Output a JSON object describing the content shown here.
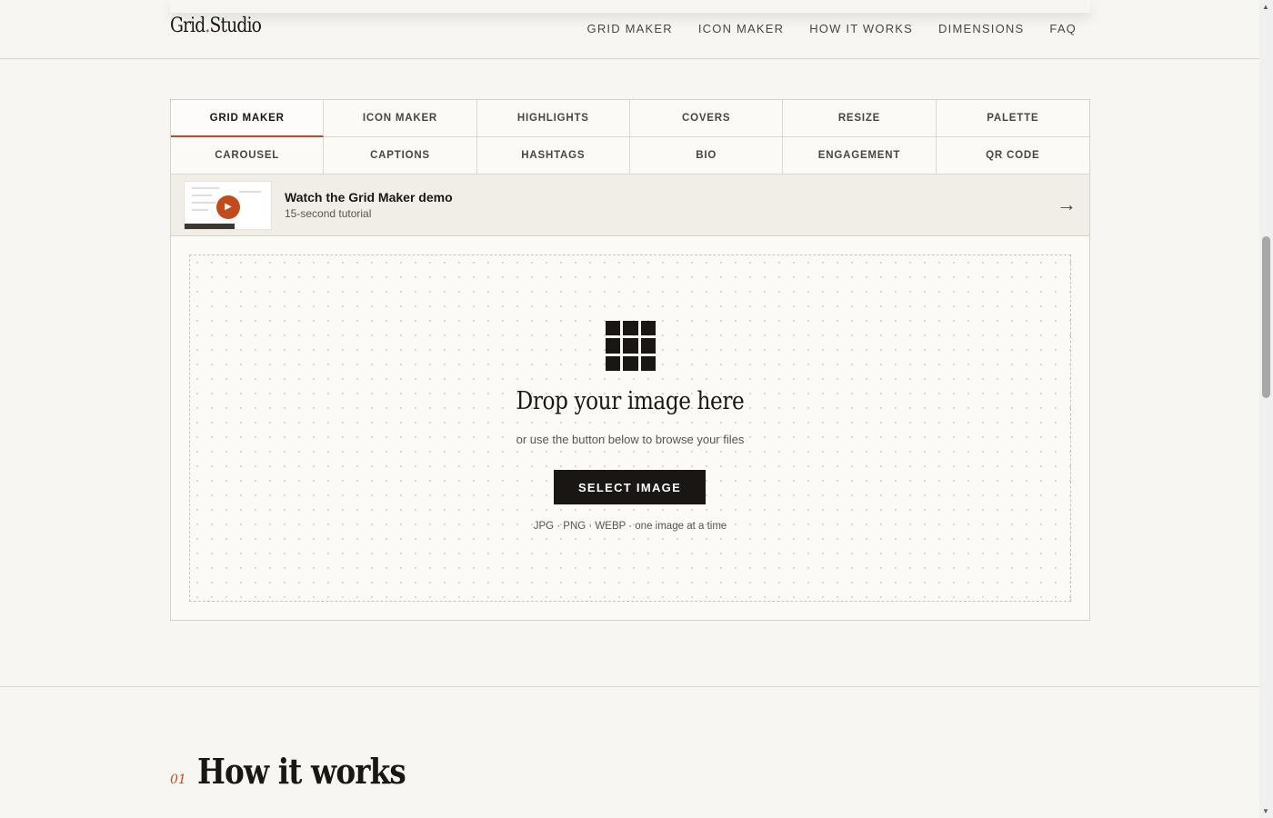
{
  "header": {
    "logo_main": "Grid",
    "logo_dot": ".",
    "logo_tail": "Studio",
    "nav": [
      "GRID MAKER",
      "ICON MAKER",
      "HOW IT WORKS",
      "DIMENSIONS",
      "FAQ"
    ]
  },
  "tabs": {
    "row1": [
      "GRID MAKER",
      "ICON MAKER",
      "HIGHLIGHTS",
      "COVERS",
      "RESIZE",
      "PALETTE"
    ],
    "row2": [
      "CAROUSEL",
      "CAPTIONS",
      "HASHTAGS",
      "BIO",
      "ENGAGEMENT",
      "QR CODE"
    ],
    "active": "GRID MAKER"
  },
  "demo": {
    "title": "Watch the Grid Maker demo",
    "subtitle": "15-second tutorial",
    "arrow": "→",
    "play_icon": "play-icon"
  },
  "dropzone": {
    "title": "Drop your image here",
    "subtitle": "or use the button below to browse your files",
    "button": "SELECT IMAGE",
    "formats": "JPG · PNG · WEBP · one image at a time"
  },
  "section": {
    "number": "01",
    "title": "How it works"
  },
  "colors": {
    "accent": "#c24b1c",
    "ink": "#1a1614",
    "background": "#f8f6f2"
  }
}
